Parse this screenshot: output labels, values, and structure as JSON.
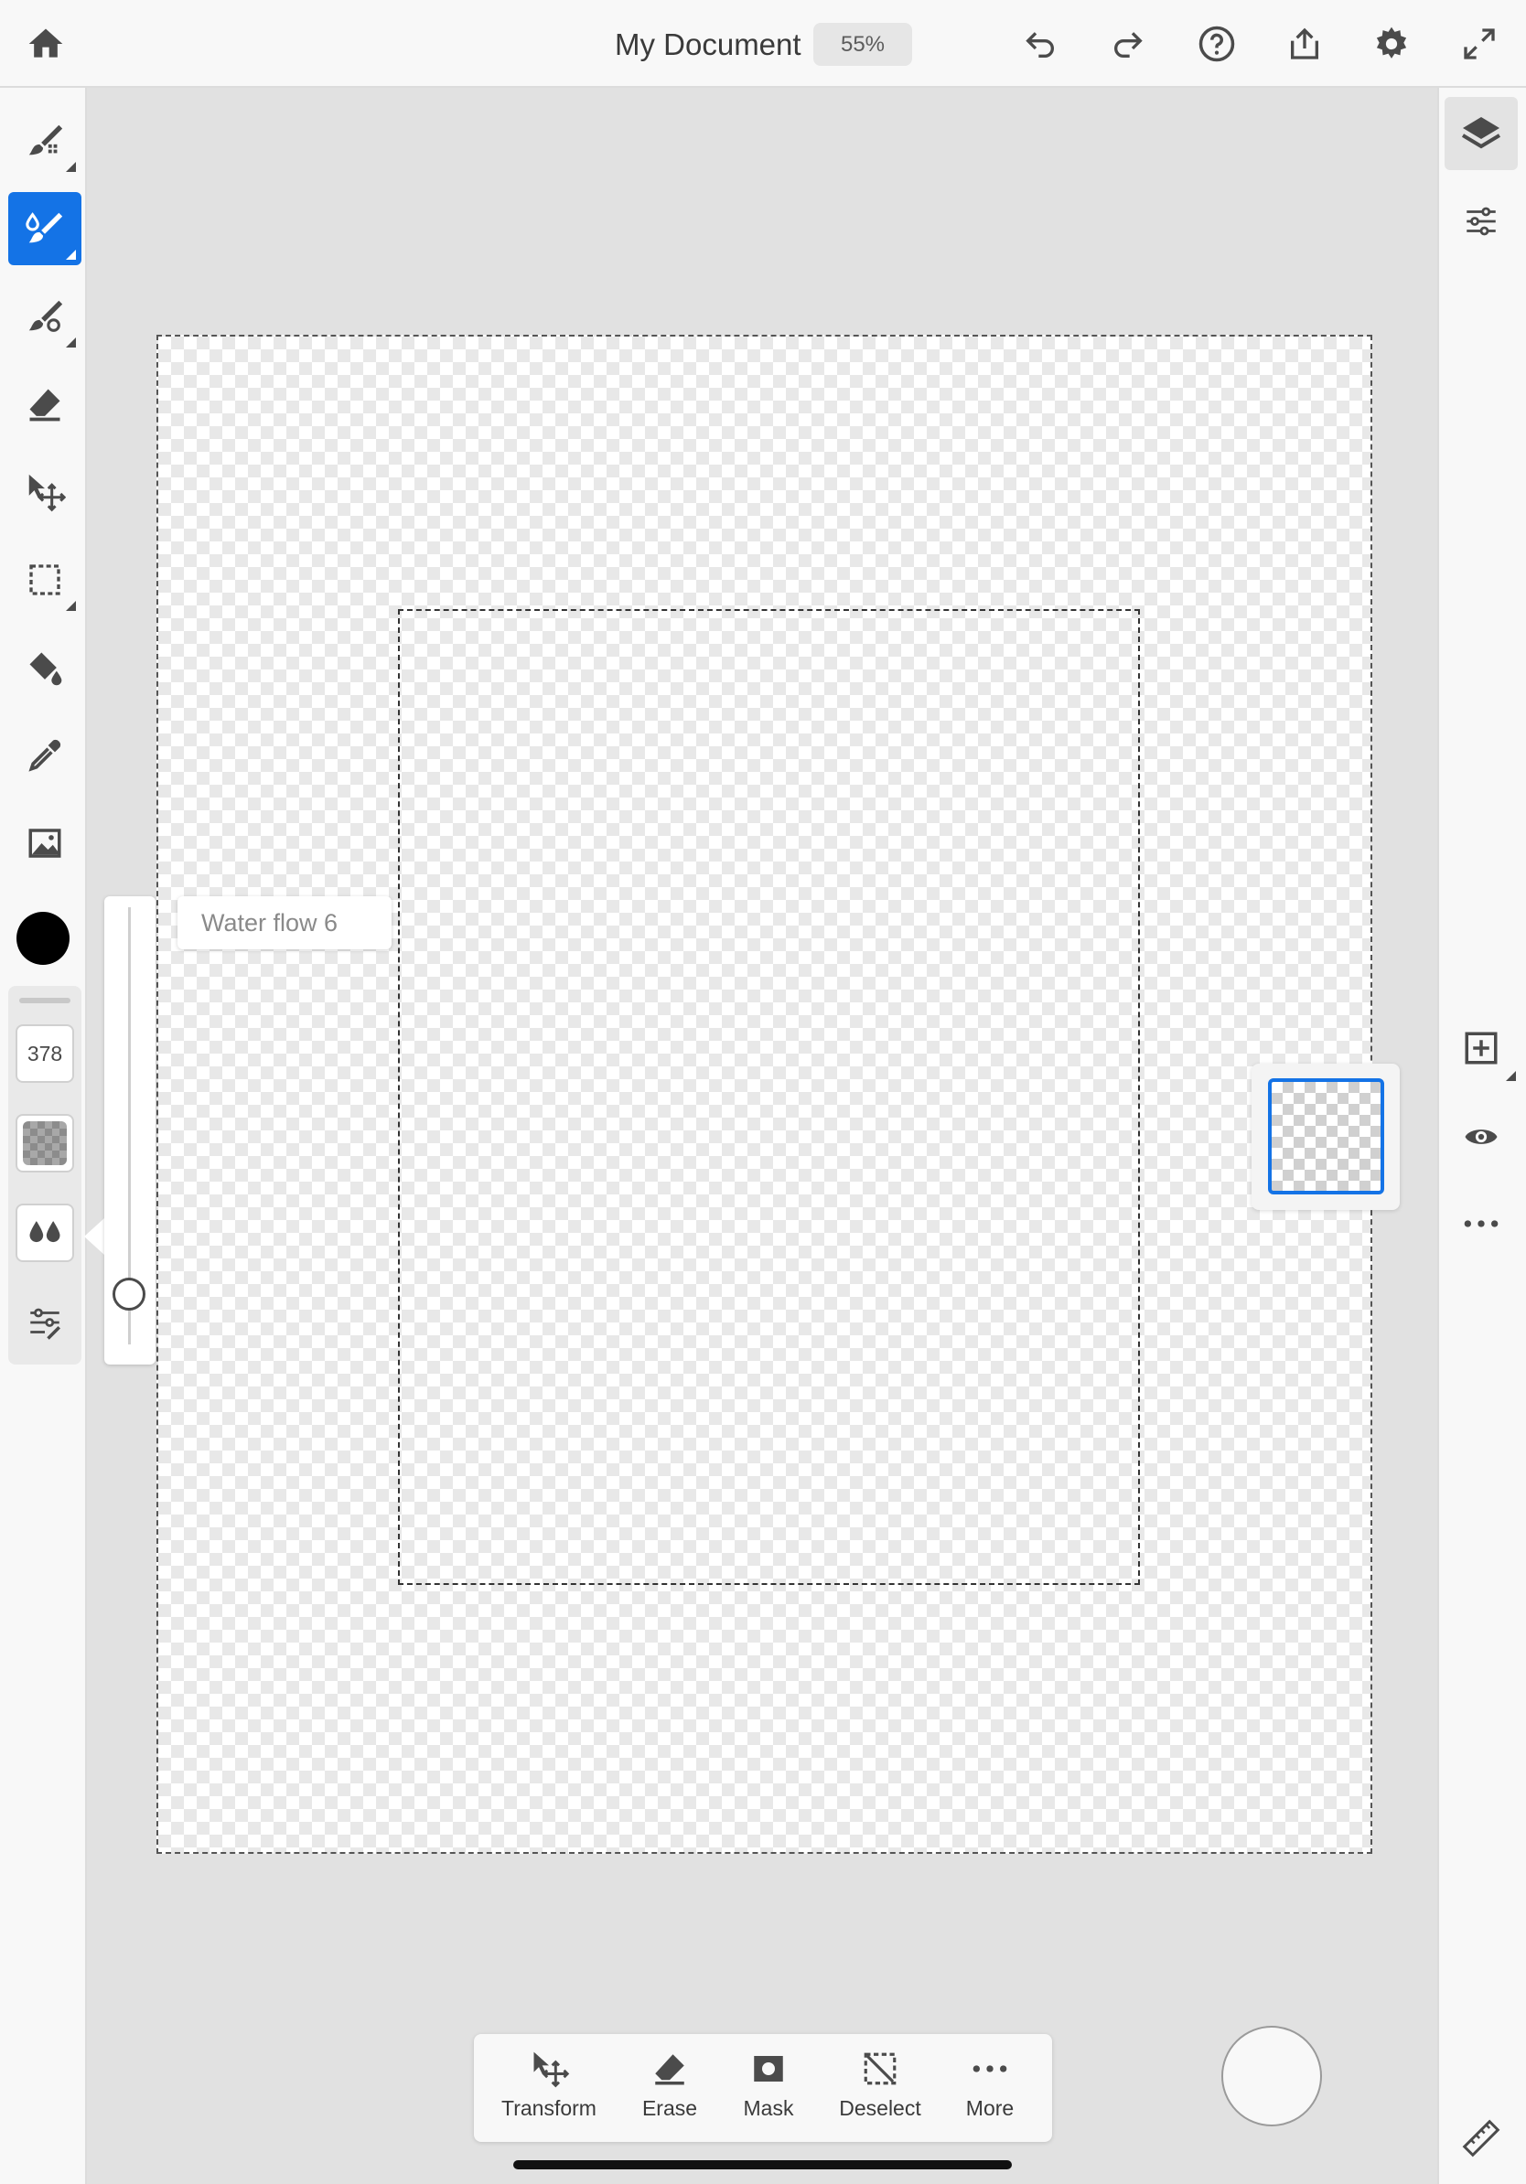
{
  "header": {
    "title": "My Document",
    "zoom": "55%",
    "icons": [
      "home-icon",
      "undo-icon",
      "redo-icon",
      "help-icon",
      "share-icon",
      "settings-icon",
      "fullscreen-icon"
    ]
  },
  "left_toolbar": {
    "tools": [
      "pixel-brush",
      "live-brush",
      "vector-brush",
      "eraser",
      "transform",
      "selection",
      "fill",
      "eyedropper",
      "image"
    ],
    "active_tool": "live-brush",
    "color": "#000000",
    "brush_size": "378"
  },
  "flow_slider": {
    "label": "Water flow 6",
    "value_fraction": 0.89
  },
  "right_panel": {
    "icons": [
      "layers-icon",
      "layer-properties-icon",
      "add-layer-icon",
      "visibility-icon",
      "more-options-icon",
      "ruler-icon"
    ]
  },
  "action_bar": {
    "items": [
      {
        "label": "Transform",
        "icon": "transform-icon"
      },
      {
        "label": "Erase",
        "icon": "eraser-icon"
      },
      {
        "label": "Mask",
        "icon": "mask-icon"
      },
      {
        "label": "Deselect",
        "icon": "deselect-icon"
      },
      {
        "label": "More",
        "icon": "more-icon"
      }
    ]
  },
  "colors": {
    "accent": "#1473e6",
    "toolbar_bg": "#f8f8f8",
    "workspace_bg": "#e1e1e1"
  }
}
